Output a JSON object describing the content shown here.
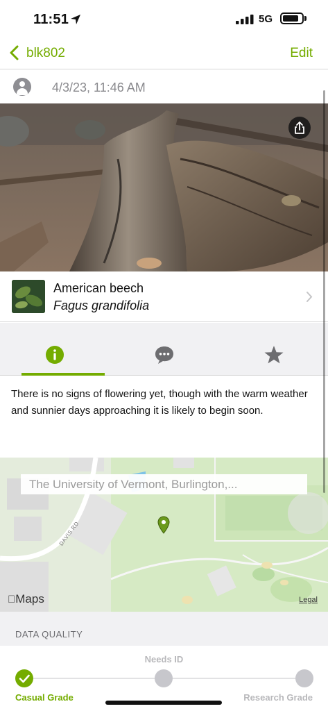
{
  "status_bar": {
    "time": "11:51",
    "network": "5G",
    "battery_level": 0.85
  },
  "nav": {
    "back_label": "blk802",
    "edit_label": "Edit"
  },
  "observation": {
    "date": "4/3/23, 11:46 AM"
  },
  "taxon": {
    "common_name": "American beech",
    "scientific_name": "Fagus grandifolia"
  },
  "tabs": [
    {
      "name": "info",
      "icon": "info-icon",
      "selected": true
    },
    {
      "name": "comments",
      "icon": "chat-bubble-icon",
      "selected": false
    },
    {
      "name": "favorites",
      "icon": "star-icon",
      "selected": false
    }
  ],
  "description": "There is no signs of flowering yet, though with the warm weather and sunnier days approaching it is likely to begin soon.",
  "map": {
    "location_text": "The University of Vermont, Burlington,...",
    "road_label": "DAVIS RD",
    "maps_logo": "Maps",
    "legal_label": "Legal"
  },
  "data_quality": {
    "header": "DATA QUALITY",
    "steps": [
      "Casual Grade",
      "Needs ID",
      "Research Grade"
    ],
    "current": "Casual Grade"
  },
  "colors": {
    "accent": "#74ac00",
    "inactive": "#c7c7cc"
  }
}
